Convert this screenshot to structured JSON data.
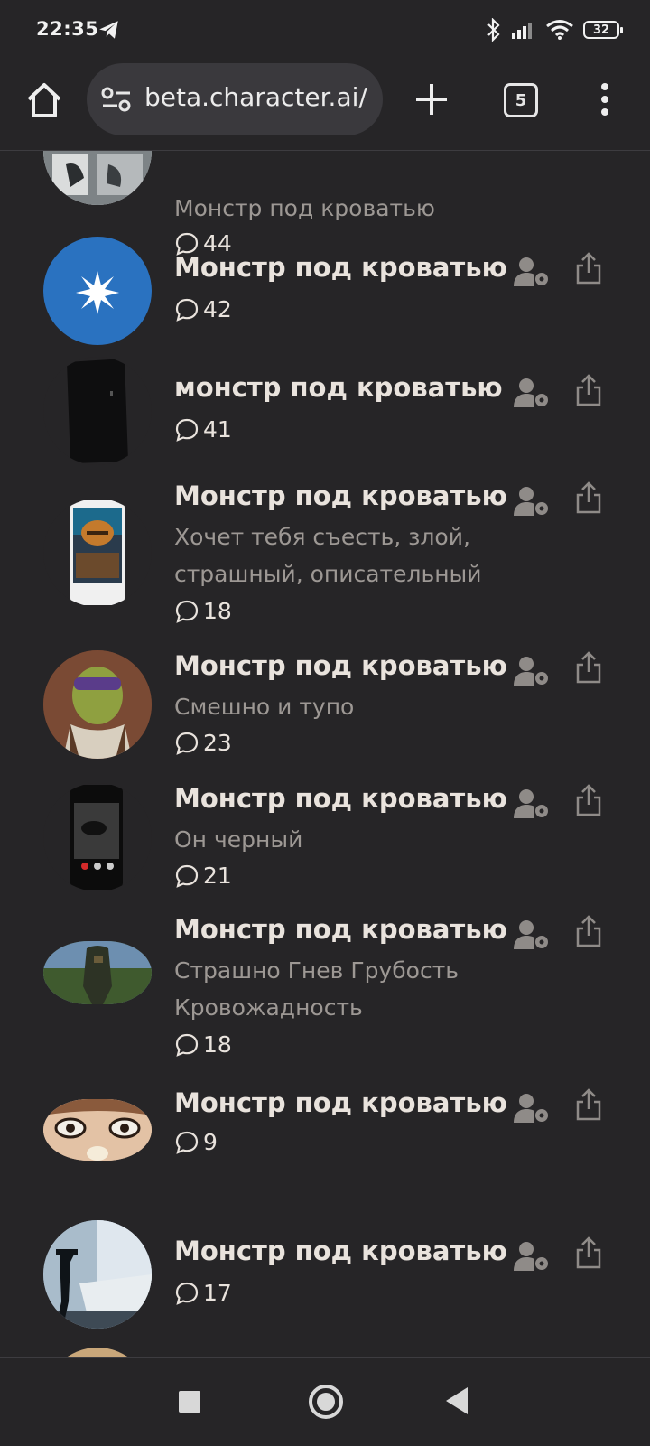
{
  "status_bar": {
    "time": "22:35",
    "battery": "32"
  },
  "browser": {
    "url": "beta.character.ai/",
    "tab_count": "5"
  },
  "items": [
    {
      "name": "",
      "description": "Монстр под кроватью",
      "count": "44"
    },
    {
      "name": "Монстр под кроватью",
      "description": "",
      "count": "42"
    },
    {
      "name": "монстр под кроватью",
      "description": "",
      "count": "41"
    },
    {
      "name": "Монстр под кроватью",
      "description_lines": [
        "Хочет тебя съесть, злой,",
        "страшный, описательный"
      ],
      "count": "18"
    },
    {
      "name": "Монстр под кроватью",
      "description": "Смешно и тупо",
      "count": "23"
    },
    {
      "name": "Монстр под кроватью",
      "description": "Он черный",
      "count": "21"
    },
    {
      "name": "Монстр под кроватью",
      "description_lines": [
        "Страшно Гнев Грубость",
        "Кровожадность"
      ],
      "count": "18"
    },
    {
      "name": "Монстр под кроватью",
      "description": "",
      "count": "9"
    },
    {
      "name": "Монстр под кроватью",
      "description": "",
      "count": "17"
    }
  ],
  "colors": {
    "background": "#262527",
    "accent_avatar_blue": "#2a72c0",
    "text": "#e9e3dd",
    "muted": "#9d9894"
  },
  "icons": [
    "home-icon",
    "site-settings-icon",
    "plus-icon",
    "tabs-icon",
    "more-vert-icon",
    "chat-bubble-icon",
    "user-settings-icon",
    "share-icon",
    "telegram-icon",
    "bluetooth-icon",
    "signal-icon",
    "wifi-icon"
  ]
}
